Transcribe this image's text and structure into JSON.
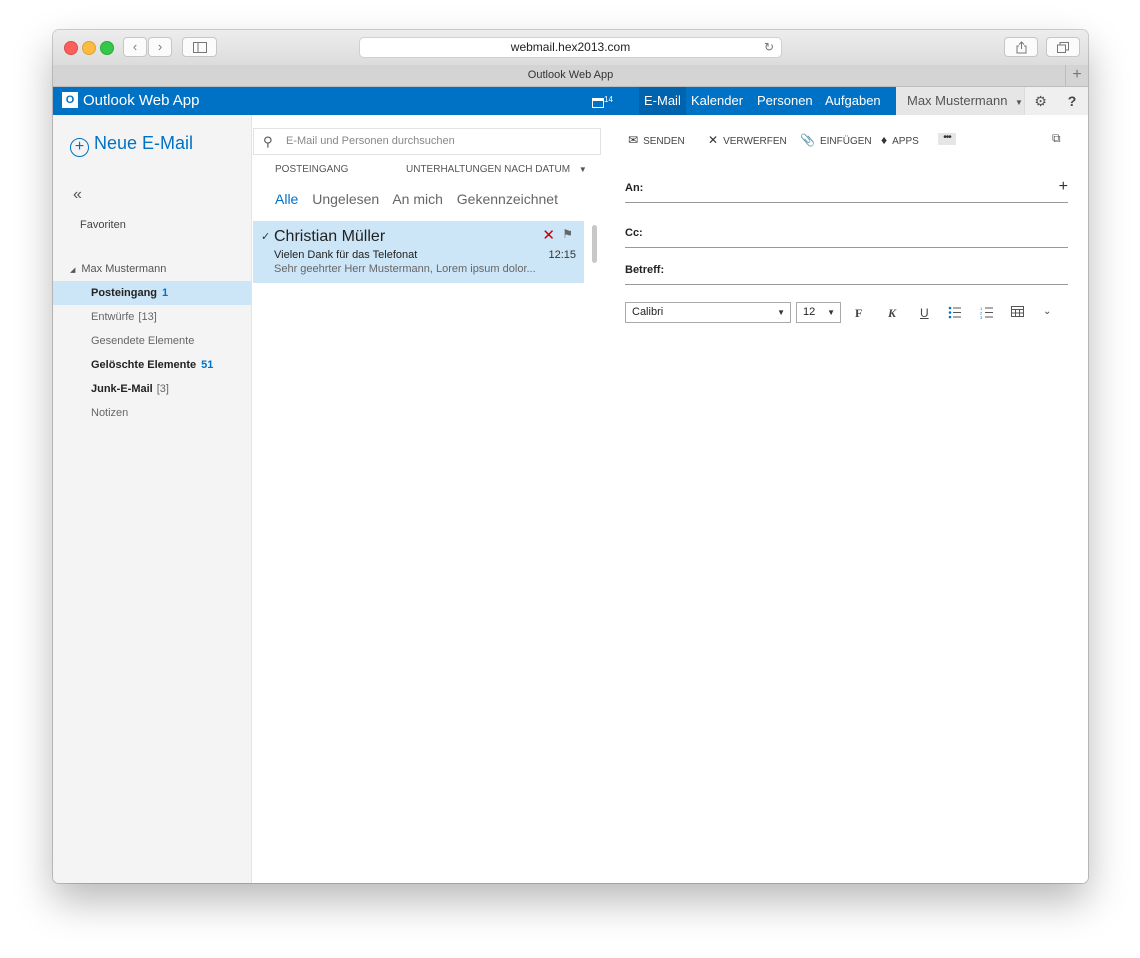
{
  "browser": {
    "url": "webmail.hex2013.com",
    "tab_title": "Outlook Web App",
    "back_icon": "chevron-left-icon",
    "forward_icon": "chevron-right-icon"
  },
  "header": {
    "app_name": "Outlook Web App",
    "calendar_count": "14",
    "nav": [
      "E-Mail",
      "Kalender",
      "Personen",
      "Aufgaben"
    ],
    "user": "Max Mustermann",
    "accent": "#0072c6"
  },
  "folders": {
    "new_mail": "Neue E-Mail",
    "favorites": "Favoriten",
    "account": "Max Mustermann",
    "items": [
      {
        "name": "Posteingang",
        "count": "1"
      },
      {
        "name": "Entwürfe",
        "count": "[13]"
      },
      {
        "name": "Gesendete Elemente",
        "count": ""
      },
      {
        "name": "Gelöschte Elemente",
        "count": "51"
      },
      {
        "name": "Junk-E-Mail",
        "count": "[3]"
      },
      {
        "name": "Notizen",
        "count": ""
      }
    ]
  },
  "list": {
    "search_placeholder": "E-Mail und Personen durchsuchen",
    "folder_label": "POSTEINGANG",
    "sort_label": "UNTERHALTUNGEN NACH DATUM",
    "filters": [
      "Alle",
      "Ungelesen",
      "An mich",
      "Gekennzeichnet"
    ],
    "messages": [
      {
        "from": "Christian Müller",
        "subject": "Vielen Dank für das Telefonat",
        "preview": "Sehr geehrter Herr Mustermann,  Lorem ipsum dolor...",
        "time": "12:15"
      }
    ]
  },
  "compose": {
    "commands": [
      "SENDEN",
      "VERWERFEN",
      "EINFÜGEN",
      "APPS"
    ],
    "more": "•••",
    "to_label": "An:",
    "cc_label": "Cc:",
    "subject_label": "Betreff:",
    "font": "Calibri",
    "font_size": "12",
    "format_buttons": [
      "F",
      "K",
      "U"
    ]
  }
}
